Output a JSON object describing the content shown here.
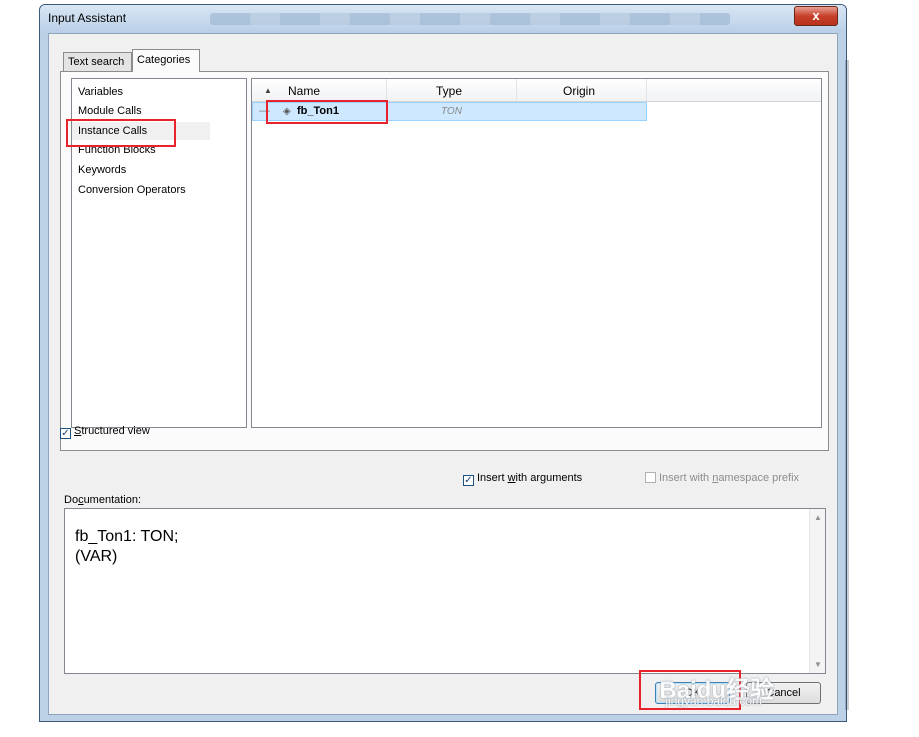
{
  "window": {
    "title": "Input Assistant",
    "close_label": "x"
  },
  "tabs": [
    {
      "label": "Text search",
      "active": false
    },
    {
      "label": "Categories",
      "active": true
    }
  ],
  "categories": {
    "items": [
      "Variables",
      "Module Calls",
      "Instance Calls",
      "Function Blocks",
      "Keywords",
      "Conversion Operators"
    ],
    "selected": "Instance Calls"
  },
  "grid": {
    "columns": [
      "Name",
      "Type",
      "Origin"
    ],
    "sort_indicator": "▲",
    "rows": [
      {
        "name": "fb_Ton1",
        "type": "TON",
        "origin": ""
      }
    ]
  },
  "options": {
    "structured_view": {
      "label_u": "S",
      "label_rest": "tructured view",
      "checked": true
    },
    "insert_with_arguments": {
      "before": "Insert ",
      "u": "w",
      "after": "ith arguments",
      "checked": true
    },
    "insert_with_namespace": {
      "before": "Insert with ",
      "u": "n",
      "after": "amespace prefix",
      "checked": false,
      "enabled": false
    }
  },
  "documentation": {
    "label_before": "Do",
    "label_u": "c",
    "label_after": "umentation:",
    "text": "fb_Ton1: TON;\n(VAR)"
  },
  "buttons": {
    "ok": "OK",
    "cancel": "Cancel"
  },
  "watermark": {
    "main": "Baidu经验",
    "sub": "jingyan.baidu.com"
  },
  "colors": {
    "highlight": "#e8232d",
    "selection": "#cde8ff",
    "title_bar": "#c5d9ef"
  }
}
